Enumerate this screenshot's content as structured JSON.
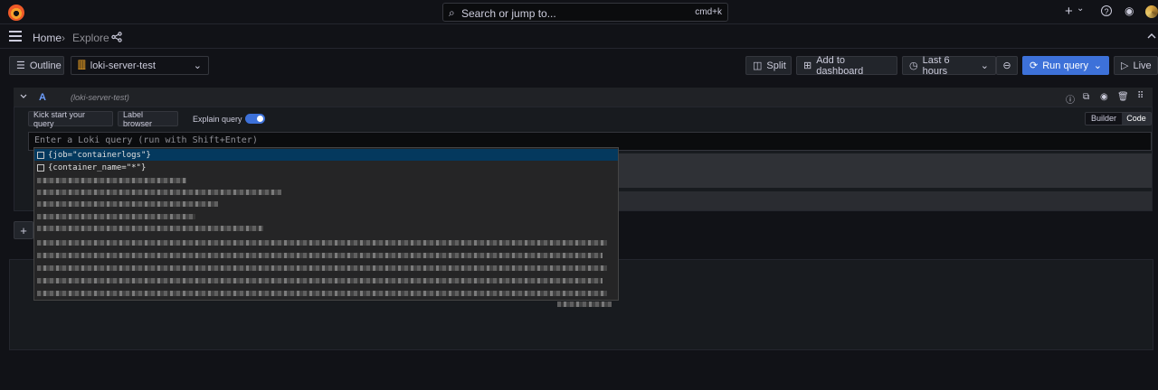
{
  "topbar": {
    "search_placeholder": "Search or jump to...",
    "search_shortcut": "cmd+k",
    "plus_label": "+",
    "caret": "⌄",
    "help_icon": "?",
    "rss_icon": "◉"
  },
  "breadcrumb": {
    "home": "Home",
    "sep": "›",
    "current": "Explore"
  },
  "toolbar": {
    "outline_label": "Outline",
    "datasource": "loki-server-test",
    "split_label": "Split",
    "add_dashboard_label": "Add to dashboard",
    "time_range": "Last 6 hours",
    "run_query_label": "Run query",
    "live_label": "Live"
  },
  "query": {
    "ref_id": "A",
    "datasource_hint": "(loki-server-test)",
    "kick_start_label": "Kick start your query",
    "label_browser_label": "Label browser",
    "explain_label": "Explain query",
    "mode_builder": "Builder",
    "mode_code": "Code",
    "editor_placeholder": "Enter a Loki query (run with Shift+Enter)"
  },
  "suggestions": [
    {
      "text": "{job=\"containerlogs\"}",
      "selected": true
    },
    {
      "text": "{container_name=\"*\"}",
      "selected": false
    }
  ],
  "add_query_label": "+"
}
